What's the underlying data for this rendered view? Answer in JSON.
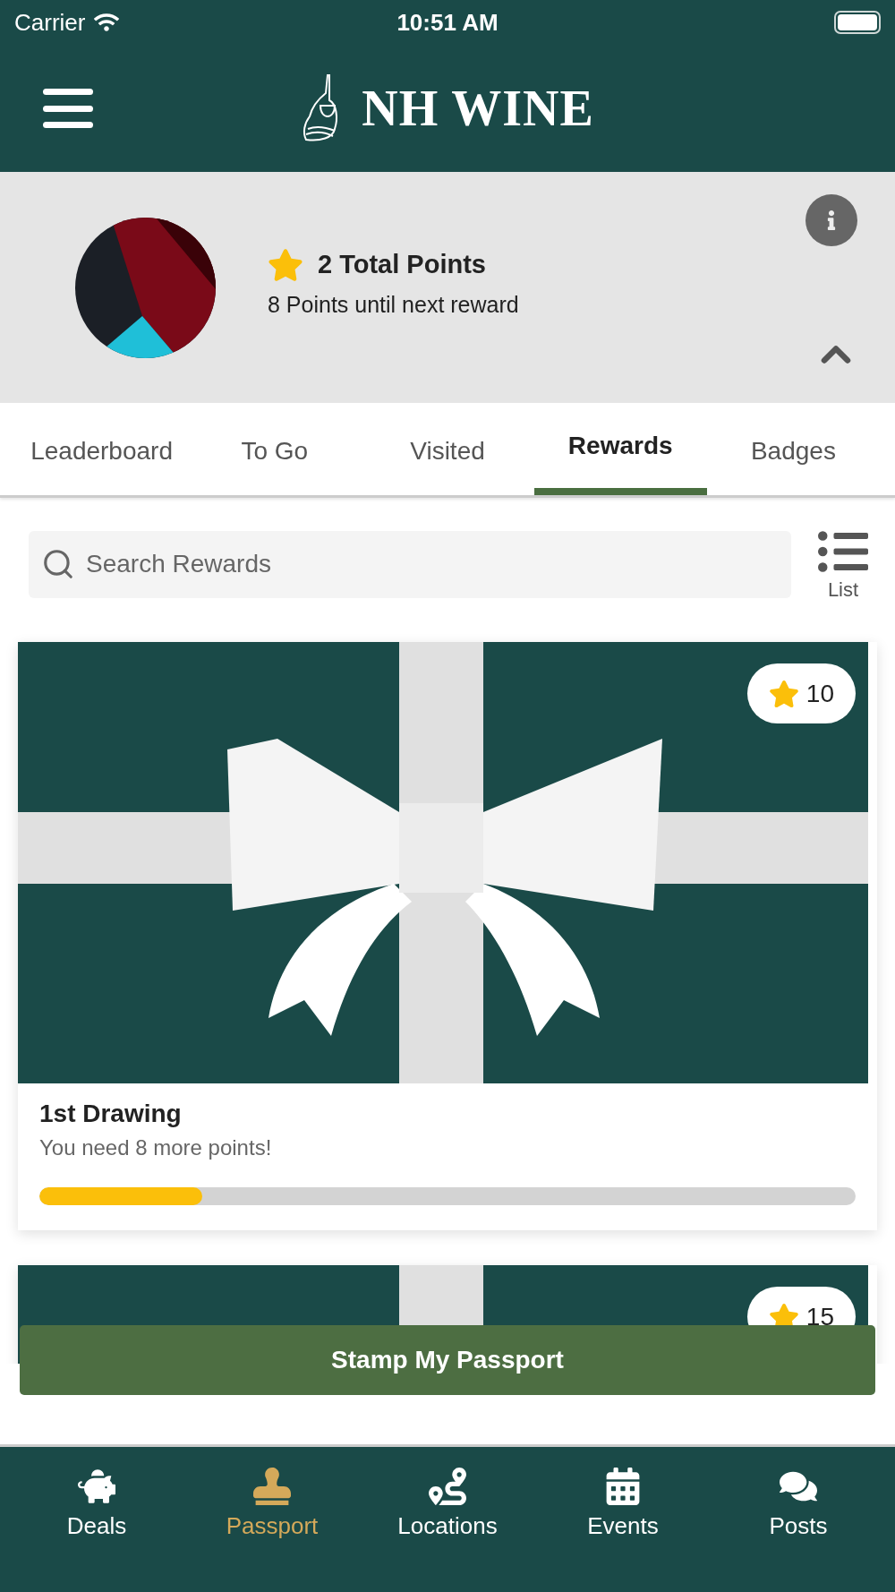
{
  "status_bar": {
    "carrier": "Carrier",
    "time": "10:51 AM"
  },
  "header": {
    "title": "NH WINE"
  },
  "profile": {
    "total_points": "2 Total Points",
    "next_reward": "8 Points until next reward"
  },
  "tabs": [
    {
      "label": "Leaderboard",
      "selected": false
    },
    {
      "label": "To Go",
      "selected": false
    },
    {
      "label": "Visited",
      "selected": false
    },
    {
      "label": "Rewards",
      "selected": true
    },
    {
      "label": "Badges",
      "selected": false
    }
  ],
  "search": {
    "placeholder": "Search Rewards"
  },
  "view_toggle": {
    "label": "List"
  },
  "rewards": [
    {
      "points": "10",
      "title": "1st Drawing",
      "subtitle": "You need 8 more points!",
      "level": 0.2
    },
    {
      "points": "15"
    }
  ],
  "stamp_button": "Stamp My Passport",
  "nav": [
    {
      "kind": "piggy",
      "label": "Deals",
      "selected": false
    },
    {
      "kind": "stamp",
      "label": "Passport",
      "selected": true
    },
    {
      "kind": "route",
      "label": "Locations",
      "selected": false
    },
    {
      "kind": "calendar",
      "label": "Events",
      "selected": false
    },
    {
      "kind": "chat",
      "label": "Posts",
      "selected": false
    }
  ]
}
